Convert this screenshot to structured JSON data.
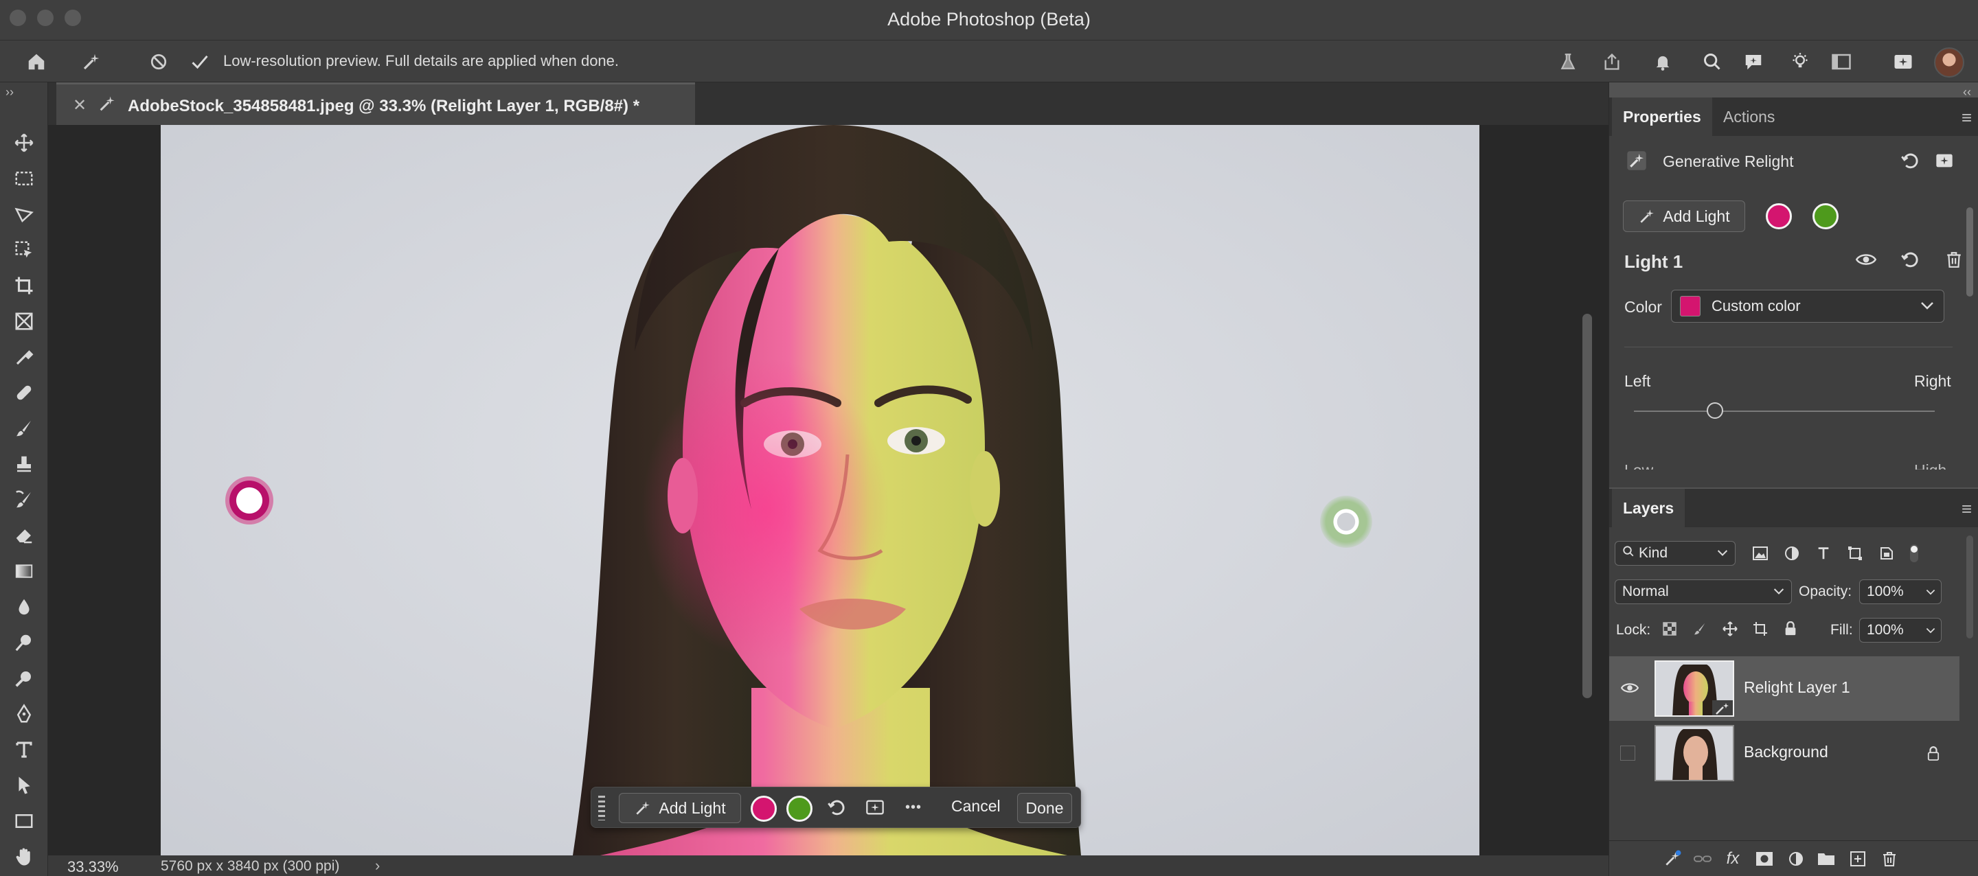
{
  "app": {
    "window_title": "Adobe Photoshop (Beta)"
  },
  "options_bar": {
    "message": "Low-resolution preview. Full details are applied when done.",
    "icons_left": [
      "home-icon",
      "generative-relight-icon",
      "cancel-icon",
      "commit-check-icon"
    ],
    "icons_right": [
      "beaker-icon",
      "share-icon",
      "bell-icon",
      "search-icon",
      "chat-icon",
      "bulb-icon",
      "workspace-icon",
      "generative-icon"
    ]
  },
  "document": {
    "tab_title": "AdobeStock_354858481.jpeg @ 33.3% (Relight Layer 1, RGB/8#) *"
  },
  "tools": [
    "move-icon",
    "marquee-icon",
    "lasso-icon",
    "object-select-icon",
    "crop-icon",
    "frame-icon",
    "eyedropper-icon",
    "healing-icon",
    "brush-icon",
    "stamp-icon",
    "history-brush-icon",
    "eraser-icon",
    "gradient-icon",
    "blur-icon",
    "dodge-icon",
    "zoom-tool-icon",
    "pen-icon",
    "type-icon",
    "path-select-icon",
    "rectangle-icon",
    "hand-icon"
  ],
  "lights": {
    "light1_color": "#d4156f",
    "light2_color": "#4e9a1c"
  },
  "context_bar": {
    "add_light": "Add Light",
    "cancel": "Cancel",
    "done": "Done",
    "more": "•••"
  },
  "status": {
    "zoom": "33.33%",
    "dimensions": "5760 px x 3840 px (300 ppi)",
    "arrow": "›"
  },
  "properties_panel": {
    "tabs": [
      "Properties",
      "Actions"
    ],
    "section_title": "Generative Relight",
    "add_light": "Add Light",
    "light_title": "Light 1",
    "color_label": "Color",
    "color_value": "Custom color",
    "slider_left": "Left",
    "slider_right": "Right",
    "slider_value": 0.27,
    "clipped_low": "Low",
    "clipped_high": "High"
  },
  "layers_panel": {
    "tab": "Layers",
    "filter": "Kind",
    "blend_mode": "Normal",
    "opacity_label": "Opacity:",
    "opacity_value": "100%",
    "lock_label": "Lock:",
    "fill_label": "Fill:",
    "fill_value": "100%",
    "layers": [
      {
        "name": "Relight Layer 1",
        "visible": true,
        "selected": true
      },
      {
        "name": "Background",
        "visible": false,
        "locked": true
      }
    ]
  }
}
